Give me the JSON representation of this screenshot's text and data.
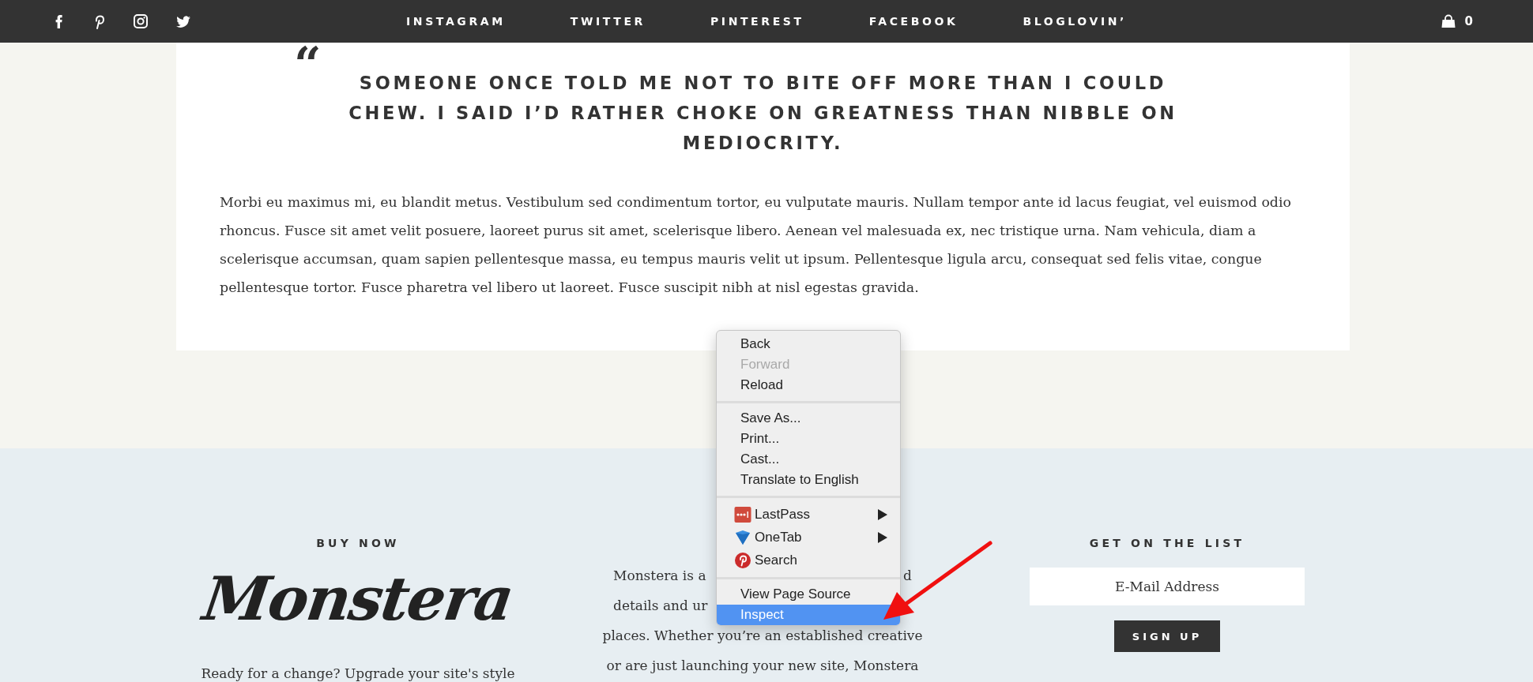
{
  "top_bar": {
    "nav_links": [
      "INSTAGRAM",
      "TWITTER",
      "PINTEREST",
      "FACEBOOK",
      "BLOGLOVIN’"
    ],
    "cart_count": "0"
  },
  "quote": {
    "mark": "“",
    "text": "SOMEONE ONCE TOLD ME NOT TO BITE OFF MORE THAN I COULD CHEW. I SAID I’D RATHER CHOKE ON GREATNESS THAN NIBBLE ON MEDIOCRITY."
  },
  "article_text": "Morbi eu maximus mi, eu blandit metus. Vestibulum sed condimentum tortor, eu vulputate mauris. Nullam tempor ante id lacus feugiat, vel euismod odio rhoncus. Fusce sit amet velit posuere, laoreet purus sit amet, scelerisque libero. Aenean vel malesuada ex, nec tristique urna. Nam vehicula, diam a scelerisque accumsan, quam sapien pellentesque massa, eu tempus mauris velit ut ipsum. Pellentesque ligula arcu, consequat sed felis vitae, congue pellentesque tortor. Fusce pharetra vel libero ut laoreet. Fusce suscipit nibh at nisl egestas gravida.",
  "footer": {
    "buy_now": {
      "heading": "BUY NOW",
      "logo": "Monstera",
      "text": "Ready for a change? Upgrade your site's style"
    },
    "about": {
      "lines": [
        {
          "before": "Monstera is a",
          "after": "d"
        },
        {
          "before": "details and ur"
        },
        {
          "text": "places. Whether you’re an established creative"
        },
        {
          "text": "or are just launching your new site, Monstera"
        }
      ]
    },
    "newsletter": {
      "heading": "GET ON THE LIST",
      "placeholder": "E-Mail Address",
      "button": "SIGN UP"
    }
  },
  "context_menu": {
    "groups": [
      [
        {
          "label": "Back",
          "kind": "item",
          "disabled": false,
          "selected": false,
          "submenu": false
        },
        {
          "label": "Forward",
          "kind": "item",
          "disabled": true,
          "selected": false,
          "submenu": false
        },
        {
          "label": "Reload",
          "kind": "item",
          "disabled": false,
          "selected": false,
          "submenu": false
        }
      ],
      [
        {
          "label": "Save As...",
          "kind": "item",
          "disabled": false,
          "selected": false,
          "submenu": false
        },
        {
          "label": "Print...",
          "kind": "item",
          "disabled": false,
          "selected": false,
          "submenu": false
        },
        {
          "label": "Cast...",
          "kind": "item",
          "disabled": false,
          "selected": false,
          "submenu": false
        },
        {
          "label": "Translate to English",
          "kind": "item",
          "disabled": false,
          "selected": false,
          "submenu": false
        }
      ],
      [
        {
          "label": "LastPass",
          "kind": "extension",
          "disabled": false,
          "selected": false,
          "submenu": true
        },
        {
          "label": "OneTab",
          "kind": "extension",
          "disabled": false,
          "selected": false,
          "submenu": true
        },
        {
          "label": "Search",
          "kind": "extension",
          "disabled": false,
          "selected": false,
          "submenu": false
        }
      ],
      [
        {
          "label": "View Page Source",
          "kind": "item",
          "disabled": false,
          "selected": false,
          "submenu": false
        },
        {
          "label": "Inspect",
          "kind": "item",
          "disabled": false,
          "selected": true,
          "submenu": false
        }
      ]
    ]
  }
}
